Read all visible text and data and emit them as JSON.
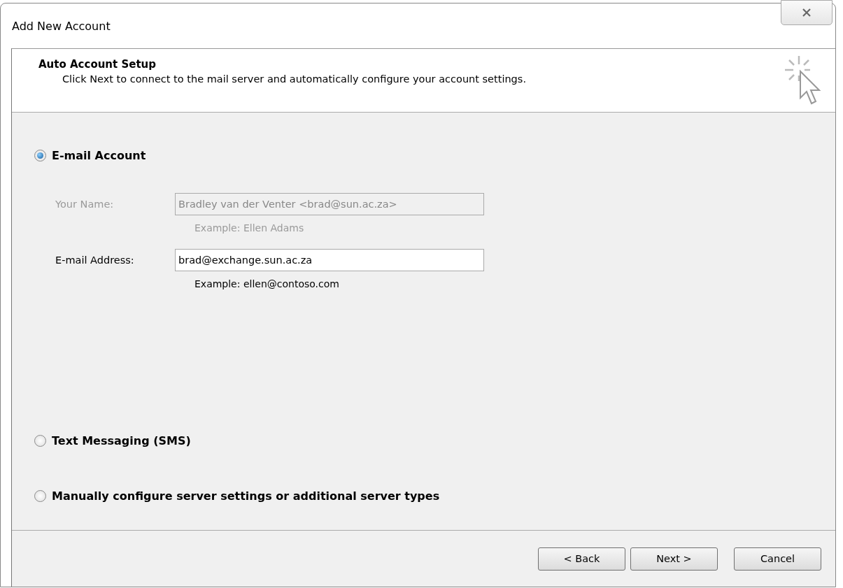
{
  "window": {
    "title": "Add New Account"
  },
  "header": {
    "title": "Auto Account Setup",
    "subtitle": "Click Next to connect to the mail server and automatically configure your account settings."
  },
  "options": [
    {
      "label": "E-mail Account",
      "selected": true
    },
    {
      "label": "Text Messaging (SMS)",
      "selected": false
    },
    {
      "label": "Manually configure server settings or additional server types",
      "selected": false
    }
  ],
  "fields": [
    {
      "label": "Your Name:",
      "value": "Bradley van der Venter <brad@sun.ac.za>",
      "example": "Example: Ellen Adams",
      "disabled": true
    },
    {
      "label": "E-mail Address:",
      "value": "brad@exchange.sun.ac.za",
      "example": "Example: ellen@contoso.com",
      "disabled": false
    }
  ],
  "buttons": [
    "< Back",
    "Next >",
    "Cancel"
  ]
}
